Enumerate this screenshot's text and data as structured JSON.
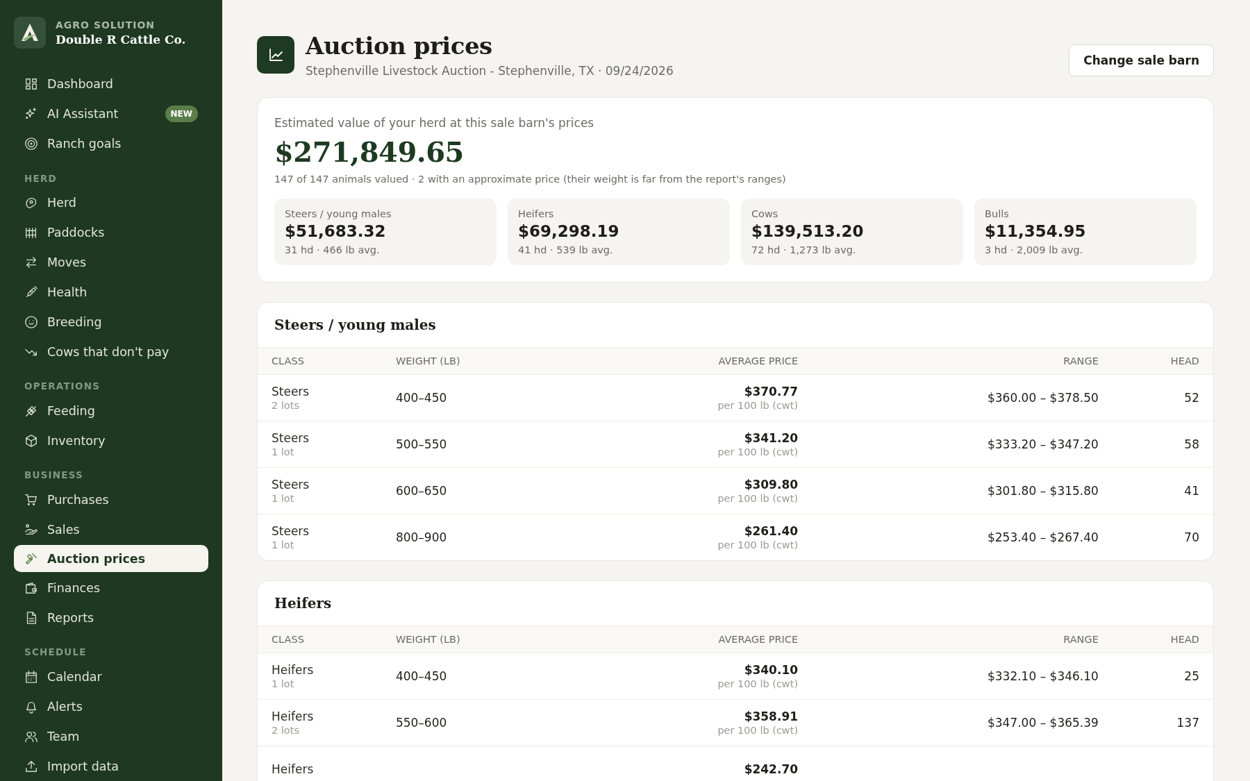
{
  "brand": {
    "kicker": "AGRO SOLUTION",
    "name": "Double R Cattle Co."
  },
  "sidebar": {
    "sections": [
      {
        "items": [
          {
            "label": "Dashboard",
            "selected": false
          },
          {
            "label": "AI Assistant",
            "badge": "NEW",
            "selected": false
          },
          {
            "label": "Ranch goals",
            "selected": false
          }
        ]
      },
      {
        "title": "HERD",
        "items": [
          {
            "label": "Herd",
            "selected": false
          },
          {
            "label": "Paddocks",
            "selected": false
          },
          {
            "label": "Moves",
            "selected": false
          },
          {
            "label": "Health",
            "selected": false
          },
          {
            "label": "Breeding",
            "selected": false
          },
          {
            "label": "Cows that don't pay",
            "selected": false
          }
        ]
      },
      {
        "title": "OPERATIONS",
        "items": [
          {
            "label": "Feeding",
            "selected": false
          },
          {
            "label": "Inventory",
            "selected": false
          }
        ]
      },
      {
        "title": "BUSINESS",
        "items": [
          {
            "label": "Purchases",
            "selected": false
          },
          {
            "label": "Sales",
            "selected": false
          },
          {
            "label": "Auction prices",
            "selected": true
          },
          {
            "label": "Finances",
            "selected": false
          },
          {
            "label": "Reports",
            "selected": false
          }
        ]
      },
      {
        "title": "SCHEDULE",
        "items": [
          {
            "label": "Calendar",
            "selected": false
          },
          {
            "label": "Alerts",
            "selected": false
          },
          {
            "label": "Team",
            "selected": false
          },
          {
            "label": "Import data",
            "selected": false
          }
        ]
      }
    ]
  },
  "header": {
    "title": "Auction prices",
    "subtitle": "Stephenville Livestock Auction - Stephenville, TX · 09/24/2026",
    "button": "Change sale barn"
  },
  "summary": {
    "label": "Estimated value of your herd at this sale barn's prices",
    "total": "$271,849.65",
    "note": "147 of 147 animals valued · 2 with an approximate price (their weight is far from the report's ranges)",
    "stats": [
      {
        "label": "Steers / young males",
        "value": "$51,683.32",
        "detail": "31 hd · 466 lb avg."
      },
      {
        "label": "Heifers",
        "value": "$69,298.19",
        "detail": "41 hd · 539 lb avg."
      },
      {
        "label": "Cows",
        "value": "$139,513.20",
        "detail": "72 hd · 1,273 lb avg."
      },
      {
        "label": "Bulls",
        "value": "$11,354.95",
        "detail": "3 hd · 2,009 lb avg."
      }
    ]
  },
  "tables": [
    {
      "title": "Steers / young males",
      "columns": [
        "CLASS",
        "WEIGHT (LB)",
        "AVERAGE PRICE",
        "RANGE",
        "HEAD"
      ],
      "rows": [
        {
          "class": "Steers",
          "lots": "2 lots",
          "weight": "400–450",
          "price": "$370.77",
          "unit": "per 100 lb (cwt)",
          "range": "$360.00 – $378.50",
          "head": "52"
        },
        {
          "class": "Steers",
          "lots": "1 lot",
          "weight": "500–550",
          "price": "$341.20",
          "unit": "per 100 lb (cwt)",
          "range": "$333.20 – $347.20",
          "head": "58"
        },
        {
          "class": "Steers",
          "lots": "1 lot",
          "weight": "600–650",
          "price": "$309.80",
          "unit": "per 100 lb (cwt)",
          "range": "$301.80 – $315.80",
          "head": "41"
        },
        {
          "class": "Steers",
          "lots": "1 lot",
          "weight": "800–900",
          "price": "$261.40",
          "unit": "per 100 lb (cwt)",
          "range": "$253.40 – $267.40",
          "head": "70"
        }
      ]
    },
    {
      "title": "Heifers",
      "columns": [
        "CLASS",
        "WEIGHT (LB)",
        "AVERAGE PRICE",
        "RANGE",
        "HEAD"
      ],
      "rows": [
        {
          "class": "Heifers",
          "lots": "1 lot",
          "weight": "400–450",
          "price": "$340.10",
          "unit": "per 100 lb (cwt)",
          "range": "$332.10 – $346.10",
          "head": "25"
        },
        {
          "class": "Heifers",
          "lots": "2 lots",
          "weight": "550–600",
          "price": "$358.91",
          "unit": "per 100 lb (cwt)",
          "range": "$347.00 – $365.39",
          "head": "137"
        },
        {
          "class": "Heifers",
          "price": "$242.70"
        }
      ]
    }
  ]
}
